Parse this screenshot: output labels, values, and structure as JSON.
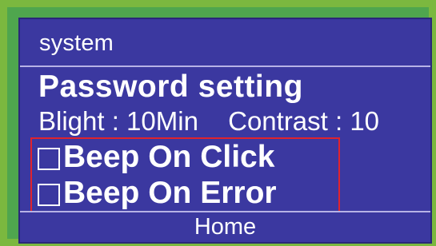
{
  "header": {
    "title": "system"
  },
  "main": {
    "heading": "Password setting",
    "blight": "Blight : 10Min",
    "contrast": "Contrast : 10"
  },
  "options": [
    {
      "label": "Beep On Click",
      "checked": false
    },
    {
      "label": "Beep On Error",
      "checked": false
    }
  ],
  "footer": {
    "home_label": "Home"
  },
  "colors": {
    "screen_bg": "#3b38a0",
    "frame": "#7bb83f",
    "selection_border": "#e0232d",
    "text": "#ffffff"
  }
}
